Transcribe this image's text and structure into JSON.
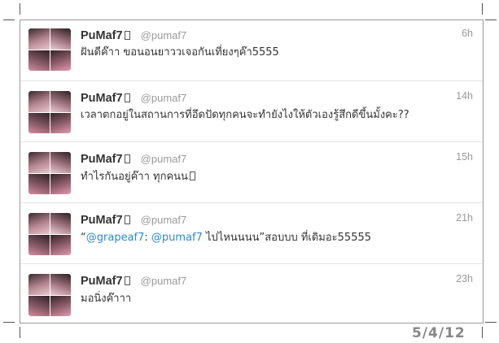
{
  "tweets": [
    {
      "name": "PuMaf7",
      "handle": "@pumaf7",
      "time": "6h",
      "text": "ฝันดีค๊าา ขอนอนยาววเจอกันเที่ยงๆค๊า5555"
    },
    {
      "name": "PuMaf7",
      "handle": "@pumaf7",
      "time": "14h",
      "text": "เวลาตกอยู่ในสถานการที่อึดปัดทุกคนจะทำยังไงให้ตัวเองรู้สึกดีขึ้นมั้งคะ??"
    },
    {
      "name": "PuMaf7",
      "handle": "@pumaf7",
      "time": "15h",
      "text": "ทำไรกันอยู่ค๊าา ทุกคนน"
    },
    {
      "name": "PuMaf7",
      "handle": "@pumaf7",
      "time": "21h",
      "quote_open": "“",
      "mention1": "@grapeaf7",
      "colon": ":",
      "mention2": "@pumaf7",
      "rest": " ไปไหนนนน”สอบบบ ที่เดิมอะ55555"
    },
    {
      "name": "PuMaf7",
      "handle": "@pumaf7",
      "time": "23h",
      "text": "มอนิ่งค๊าาา"
    }
  ],
  "stamp": "5/4/12",
  "colors": {
    "mention": "#2a8bd1",
    "name": "#333333",
    "meta": "#9a9a9a"
  }
}
